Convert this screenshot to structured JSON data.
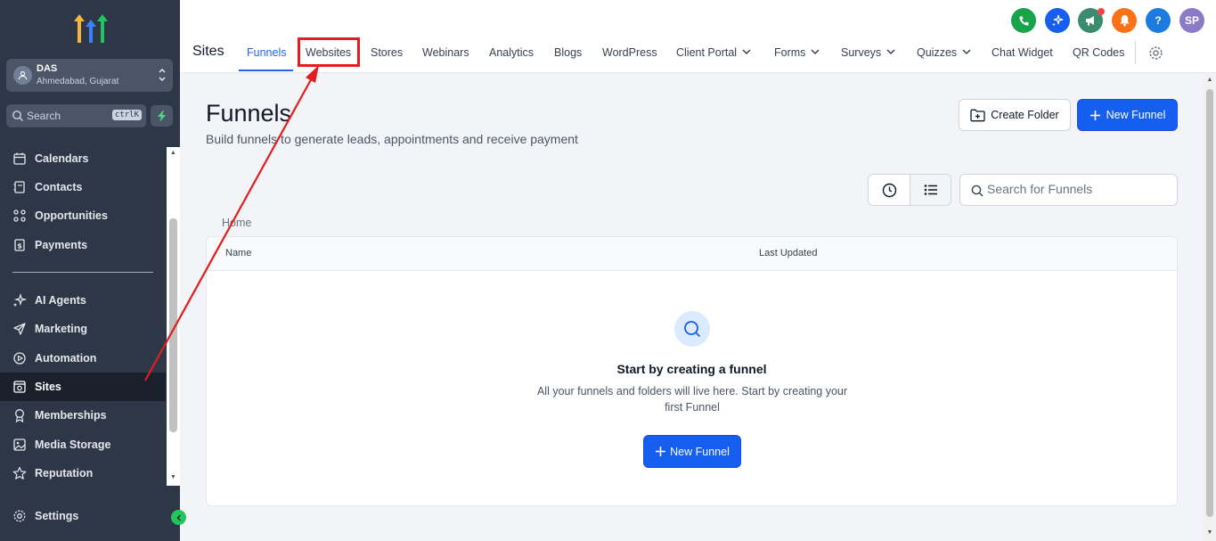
{
  "account": {
    "name": "DAS",
    "location": "Ahmedabad, Gujarat"
  },
  "sidebar_search": {
    "placeholder": "Search",
    "shortcut": "ctrlK"
  },
  "sidebar": {
    "items": [
      {
        "label": "Calendars",
        "icon": "calendar-icon"
      },
      {
        "label": "Contacts",
        "icon": "contacts-icon"
      },
      {
        "label": "Opportunities",
        "icon": "opportunities-icon"
      },
      {
        "label": "Payments",
        "icon": "payments-icon"
      },
      {
        "label": "AI Agents",
        "icon": "sparkle-icon"
      },
      {
        "label": "Marketing",
        "icon": "send-icon"
      },
      {
        "label": "Automation",
        "icon": "automation-icon"
      },
      {
        "label": "Sites",
        "icon": "sites-icon",
        "active": true
      },
      {
        "label": "Memberships",
        "icon": "award-icon"
      },
      {
        "label": "Media Storage",
        "icon": "image-icon"
      },
      {
        "label": "Reputation",
        "icon": "star-icon"
      }
    ],
    "settings_label": "Settings"
  },
  "header": {
    "section_title": "Sites",
    "tabs": [
      {
        "label": "Funnels",
        "active": true
      },
      {
        "label": "Websites",
        "highlighted": true
      },
      {
        "label": "Stores"
      },
      {
        "label": "Webinars"
      },
      {
        "label": "Analytics"
      },
      {
        "label": "Blogs"
      },
      {
        "label": "WordPress"
      },
      {
        "label": "Client Portal",
        "dropdown": true
      },
      {
        "label": "Forms",
        "dropdown": true
      },
      {
        "label": "Surveys",
        "dropdown": true
      },
      {
        "label": "Quizzes",
        "dropdown": true
      },
      {
        "label": "Chat Widget"
      },
      {
        "label": "QR Codes"
      }
    ],
    "user_initials": "SP",
    "help_label": "?"
  },
  "page": {
    "title": "Funnels",
    "subtitle": "Build funnels to generate leads, appointments and receive payment",
    "create_folder_label": "Create Folder",
    "new_funnel_label": "New Funnel",
    "search_placeholder": "Search for Funnels",
    "breadcrumb": "Home"
  },
  "table": {
    "columns": [
      "Name",
      "Last Updated"
    ],
    "empty_title": "Start by creating a funnel",
    "empty_description": "All your funnels and folders will live here. Start by creating your first Funnel",
    "empty_button_label": "New Funnel"
  },
  "colors": {
    "sidebar_bg": "#2d3748",
    "accent_blue": "#155eef",
    "annotation_red": "#e11d1d",
    "phone_green": "#16a34a",
    "megaphone_teal": "#3d8b6e",
    "bell_orange": "#f97316",
    "help_blue": "#1d7be0",
    "avatar_purple": "#8b7bc7"
  }
}
